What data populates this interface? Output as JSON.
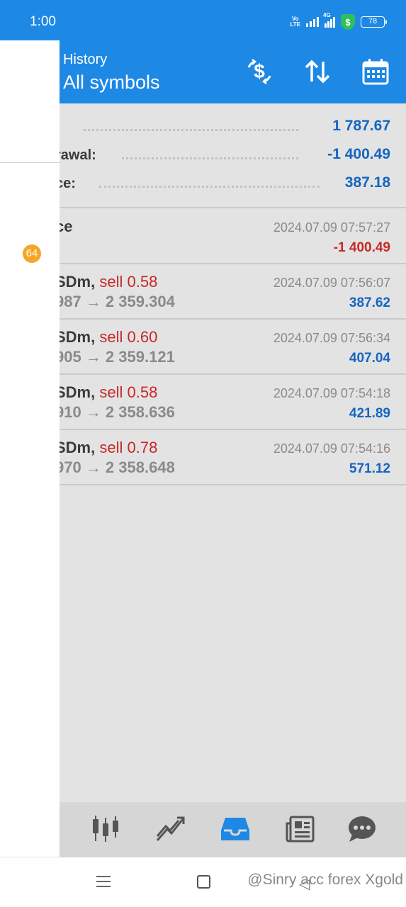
{
  "status_bar": {
    "time": "1:00",
    "volte": "Vo LTE",
    "net": "4G",
    "shield": "$",
    "battery": "78"
  },
  "header": {
    "subtitle": "History",
    "title": "All symbols"
  },
  "actions": [
    "deposit-exchange-icon",
    "sort-icon",
    "calendar-icon"
  ],
  "summary": [
    {
      "label": "",
      "value": "1 787.67"
    },
    {
      "label": "rawal:",
      "value": "-1 400.49"
    },
    {
      "label": "ce:",
      "value": "387.18"
    }
  ],
  "deals": [
    {
      "symbol": "ce",
      "side": "",
      "price": "",
      "date": "2024.07.09 07:57:27",
      "amount": "-1 400.49",
      "negative": true
    },
    {
      "symbol": "SDm, ",
      "side": "sell 0.58",
      "price": "987 → 2 359.304",
      "date": "2024.07.09 07:56:07",
      "amount": "387.62",
      "negative": false
    },
    {
      "symbol": "SDm, ",
      "side": "sell 0.60",
      "price": "905 → 2 359.121",
      "date": "2024.07.09 07:56:34",
      "amount": "407.04",
      "negative": false
    },
    {
      "symbol": "SDm, ",
      "side": "sell 0.58",
      "price": "910 → 2 358.636",
      "date": "2024.07.09 07:54:18",
      "amount": "421.89",
      "negative": false
    },
    {
      "symbol": "SDm, ",
      "side": "sell 0.78",
      "price": "970 → 2 358.648",
      "date": "2024.07.09 07:54:16",
      "amount": "571.12",
      "negative": false
    }
  ],
  "drawer": {
    "badge": "64"
  },
  "bottom_nav": [
    "quotes-icon",
    "chart-icon",
    "history-icon",
    "news-icon",
    "chat-icon"
  ],
  "bottom_nav_active": "history-icon",
  "watermark": "@Sinry acc forex Xgold",
  "colors": {
    "accent": "#1e88e5",
    "profit": "#1565c0",
    "loss": "#c62828",
    "badge": "#f5a623"
  }
}
